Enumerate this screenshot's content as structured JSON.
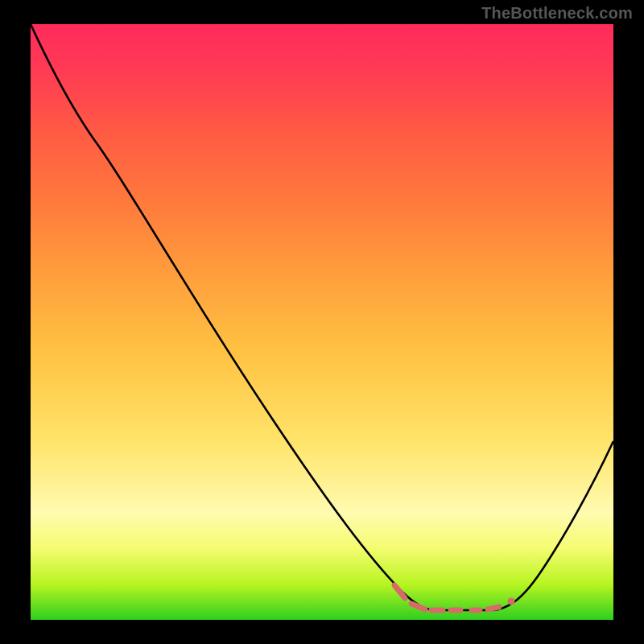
{
  "watermark": "TheBottleneck.com",
  "colors": {
    "background": "#000000",
    "curve": "#000000",
    "markers": "#d86a6a",
    "gradient_top": "#ff2a5c",
    "gradient_bottom": "#2fce1f"
  },
  "chart_data": {
    "type": "line",
    "title": "",
    "xlabel": "",
    "ylabel": "",
    "xlim": [
      0,
      100
    ],
    "ylim": [
      0,
      100
    ],
    "grid": false,
    "legend": false,
    "annotations": [
      "TheBottleneck.com"
    ],
    "series": [
      {
        "name": "bottleneck-curve",
        "color": "#000000",
        "x": [
          0,
          5,
          10,
          15,
          20,
          25,
          30,
          35,
          40,
          45,
          50,
          55,
          60,
          62,
          65,
          68,
          72,
          76,
          80,
          82,
          85,
          90,
          95,
          100
        ],
        "values": [
          100,
          93,
          87,
          82,
          77,
          71,
          63,
          55,
          47,
          39,
          31,
          23,
          15,
          10,
          6,
          3,
          2,
          2,
          2,
          3,
          6,
          13,
          22,
          30
        ]
      }
    ],
    "highlight_range": {
      "name": "minimum-plateau",
      "color": "#d86a6a",
      "x_start": 62,
      "x_end": 82,
      "value": 2
    },
    "background_gradient": {
      "direction": "vertical",
      "stops": [
        {
          "pos": 0.0,
          "color": "#ff2a5c"
        },
        {
          "pos": 0.3,
          "color": "#ff7a3c"
        },
        {
          "pos": 0.55,
          "color": "#ffc242"
        },
        {
          "pos": 0.82,
          "color": "#fffbb0"
        },
        {
          "pos": 0.94,
          "color": "#b8f522"
        },
        {
          "pos": 1.0,
          "color": "#2fce1f"
        }
      ]
    }
  }
}
